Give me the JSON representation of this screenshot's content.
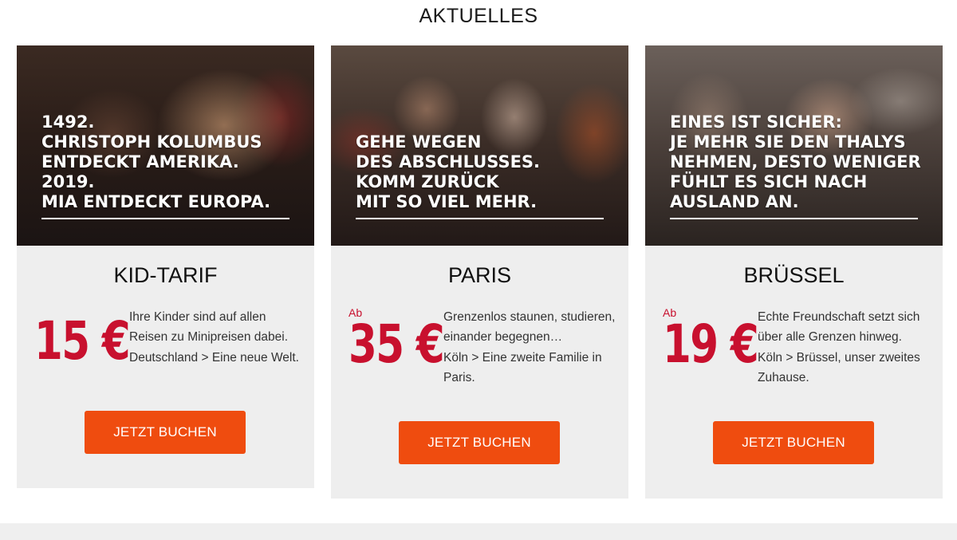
{
  "section": {
    "title": "AKTUELLES"
  },
  "cards": [
    {
      "headline": "1492.\nCHRISTOPH KOLUMBUS\nENTDECKT AMERIKA.\n2019.\nMIA ENTDECKT EUROPA.",
      "title": "KID-TARIF",
      "price_prefix": "",
      "price": "15 €",
      "description": [
        "Ihre Kinder sind auf allen Reisen zu Minipreisen dabei.",
        "Deutschland > Eine neue Welt."
      ],
      "cta": "JETZT BUCHEN"
    },
    {
      "headline": "GEHE WEGEN\nDES ABSCHLUSSES.\nKOMM ZURÜCK\nMIT SO VIEL MEHR.",
      "title": "PARIS",
      "price_prefix": "Ab",
      "price": "35 €",
      "description": [
        "Grenzenlos staunen, studieren, einander begegnen…",
        "Köln > Eine zweite Familie in Paris."
      ],
      "cta": "JETZT BUCHEN"
    },
    {
      "headline": "EINES IST SICHER:\nJE MEHR SIE DEN THALYS\nNEHMEN, DESTO WENIGER\nFÜHLT ES SICH NACH\nAUSLAND AN.",
      "title": "BRÜSSEL",
      "price_prefix": "Ab",
      "price": "19 €",
      "description": [
        "Echte Freundschaft setzt sich über alle Grenzen hinweg.",
        "Köln > Brüssel, unser zweites Zuhause."
      ],
      "cta": "JETZT BUCHEN"
    }
  ],
  "colors": {
    "accent": "#ef4c0f",
    "price": "#c8102e",
    "card_bg": "#eeeeee"
  }
}
